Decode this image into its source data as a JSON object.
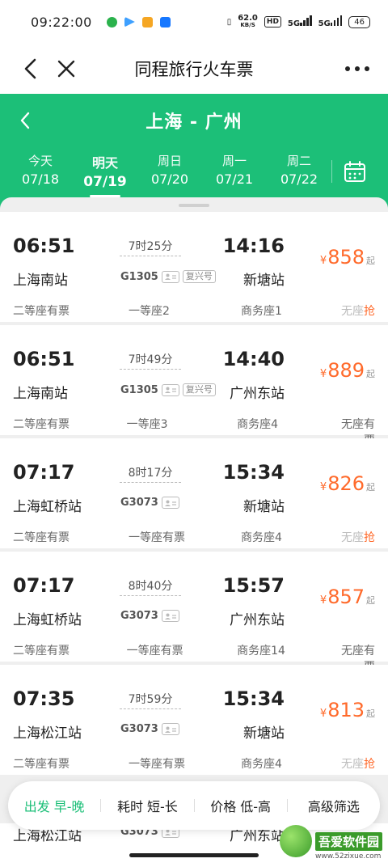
{
  "status": {
    "time": "09:22:00",
    "net_speed": "62.0",
    "net_unit": "KB/S",
    "hd": "HD",
    "sig1": "5G",
    "sig2": "5G",
    "battery": "46"
  },
  "navbar": {
    "title": "同程旅行火车票"
  },
  "header": {
    "route": "上海 - 广州",
    "dates": [
      {
        "wk": "今天",
        "dt": "07/18"
      },
      {
        "wk": "明天",
        "dt": "07/19"
      },
      {
        "wk": "周日",
        "dt": "07/20"
      },
      {
        "wk": "周一",
        "dt": "07/21"
      },
      {
        "wk": "周二",
        "dt": "07/22"
      }
    ],
    "active_index": 1
  },
  "trains": [
    {
      "dep": "06:51",
      "arr": "14:16",
      "dur": "7时25分",
      "from": "上海南站",
      "to": "新塘站",
      "code": "G1305",
      "tag": "复兴号",
      "price": "858",
      "seat1": "二等座有票",
      "seat2": "一等座2",
      "seat3": "商务座1",
      "seat4": "无座",
      "seat4_grab": "抢"
    },
    {
      "dep": "06:51",
      "arr": "14:40",
      "dur": "7时49分",
      "from": "上海南站",
      "to": "广州东站",
      "code": "G1305",
      "tag": "复兴号",
      "price": "889",
      "seat1": "二等座有票",
      "seat2": "一等座3",
      "seat3": "商务座4",
      "seat4": "无座有票",
      "seat4_grab": ""
    },
    {
      "dep": "07:17",
      "arr": "15:34",
      "dur": "8时17分",
      "from": "上海虹桥站",
      "to": "新塘站",
      "code": "G3073",
      "tag": "",
      "price": "826",
      "seat1": "二等座有票",
      "seat2": "一等座有票",
      "seat3": "商务座4",
      "seat4": "无座",
      "seat4_grab": "抢"
    },
    {
      "dep": "07:17",
      "arr": "15:57",
      "dur": "8时40分",
      "from": "上海虹桥站",
      "to": "广州东站",
      "code": "G3073",
      "tag": "",
      "price": "857",
      "seat1": "二等座有票",
      "seat2": "一等座有票",
      "seat3": "商务座14",
      "seat4": "无座有票",
      "seat4_grab": ""
    },
    {
      "dep": "07:35",
      "arr": "15:34",
      "dur": "7时59分",
      "from": "上海松江站",
      "to": "新塘站",
      "code": "G3073",
      "tag": "",
      "price": "813",
      "seat1": "二等座有票",
      "seat2": "一等座有票",
      "seat3": "商务座4",
      "seat4": "无座",
      "seat4_grab": "抢"
    }
  ],
  "peek": {
    "from": "上海松江站",
    "code": "G3073",
    "to": "广州东站"
  },
  "price_unit": "¥",
  "price_suffix": "起",
  "filters": [
    "出发 早-晚",
    "耗时 短-长",
    "价格 低-高",
    "高级筛选"
  ],
  "filter_active": 0,
  "watermark": {
    "name": "吾爱软件园",
    "url": "www.52zixue.com"
  },
  "colors": {
    "accent": "#1cbf78",
    "price": "#ff6a2b"
  }
}
